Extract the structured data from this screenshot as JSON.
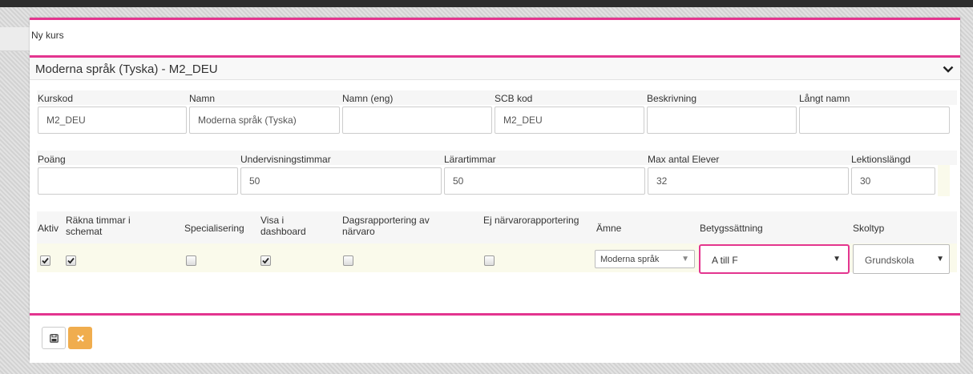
{
  "dialog": {
    "title": "Ny kurs"
  },
  "panel": {
    "title": "Moderna språk (Tyska) - M2_DEU"
  },
  "row1": {
    "headers": [
      "Kurskod",
      "Namn",
      "Namn (eng)",
      "SCB kod",
      "Beskrivning",
      "Långt namn"
    ],
    "values": [
      "M2_DEU",
      "Moderna språk (Tyska)",
      "",
      "M2_DEU",
      "",
      ""
    ]
  },
  "row2": {
    "headers": [
      "Poäng",
      "Undervisningstimmar",
      "Lärartimmar",
      "Max antal Elever",
      "Lektionslängd"
    ],
    "values": [
      "",
      "50",
      "50",
      "32",
      "30"
    ]
  },
  "row3": {
    "headers": [
      "Aktiv",
      "Räkna timmar i schemat",
      "Specialisering",
      "Visa i dashboard",
      "Dagsrapportering av närvaro",
      "Ej närvarorapportering",
      "Ämne",
      "Betygssättning",
      "Skoltyp"
    ],
    "checkboxes": {
      "aktiv": true,
      "rakna_timmar": true,
      "specialisering": false,
      "visa_dashboard": true,
      "dagsrapportering": false,
      "ej_narvaro": false
    },
    "amne_value": "Moderna språk",
    "betyg_value": "A till F",
    "skoltyp_value": "Grundskola"
  },
  "colors": {
    "accent": "#e3358f",
    "cancel": "#f0ad4e",
    "highlight_row": "#fafaeb"
  },
  "icons": {
    "save": "floppy-disk-icon",
    "cancel": "close-icon",
    "collapse": "chevron-down-icon"
  }
}
